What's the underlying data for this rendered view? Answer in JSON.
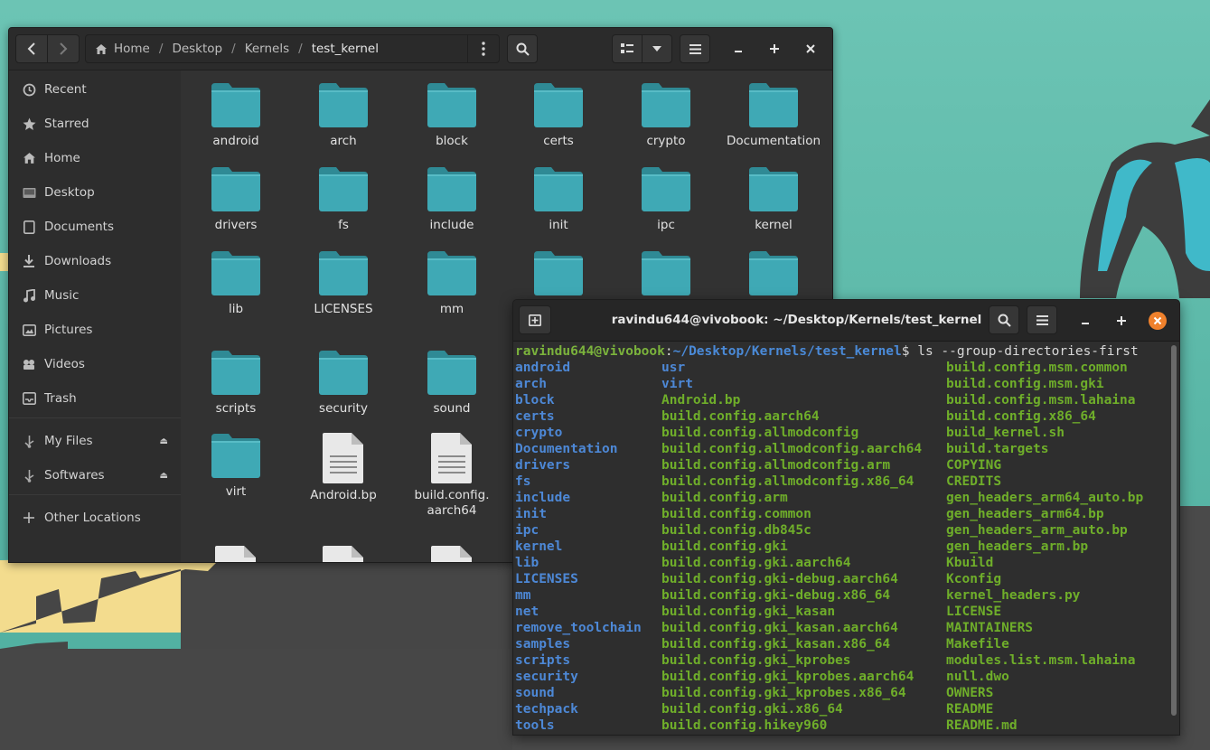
{
  "file_manager": {
    "breadcrumbs": [
      "Home",
      "Desktop",
      "Kernels",
      "test_kernel"
    ],
    "sidebar": [
      {
        "label": "Recent",
        "icon": "clock-icon"
      },
      {
        "label": "Starred",
        "icon": "star-icon"
      },
      {
        "label": "Home",
        "icon": "home-icon"
      },
      {
        "label": "Desktop",
        "icon": "desktop-icon"
      },
      {
        "label": "Documents",
        "icon": "document-icon"
      },
      {
        "label": "Downloads",
        "icon": "download-icon"
      },
      {
        "label": "Music",
        "icon": "music-icon"
      },
      {
        "label": "Pictures",
        "icon": "picture-icon"
      },
      {
        "label": "Videos",
        "icon": "video-icon"
      },
      {
        "label": "Trash",
        "icon": "trash-icon"
      },
      {
        "label": "My Files",
        "icon": "usb-drive-icon"
      },
      {
        "label": "Softwares",
        "icon": "usb-drive-icon"
      },
      {
        "label": "Other Locations",
        "icon": "plus-icon"
      }
    ],
    "items": [
      {
        "label": "android",
        "type": "folder"
      },
      {
        "label": "arch",
        "type": "folder"
      },
      {
        "label": "block",
        "type": "folder"
      },
      {
        "label": "certs",
        "type": "folder"
      },
      {
        "label": "crypto",
        "type": "folder"
      },
      {
        "label": "Documentation",
        "type": "folder"
      },
      {
        "label": "drivers",
        "type": "folder"
      },
      {
        "label": "fs",
        "type": "folder"
      },
      {
        "label": "include",
        "type": "folder"
      },
      {
        "label": "init",
        "type": "folder"
      },
      {
        "label": "ipc",
        "type": "folder"
      },
      {
        "label": "kernel",
        "type": "folder"
      },
      {
        "label": "lib",
        "type": "folder"
      },
      {
        "label": "LICENSES",
        "type": "folder"
      },
      {
        "label": "mm",
        "type": "folder"
      },
      {
        "label": "",
        "type": "folder"
      },
      {
        "label": "",
        "type": "folder"
      },
      {
        "label": "",
        "type": "folder"
      },
      {
        "label": "scripts",
        "type": "folder"
      },
      {
        "label": "security",
        "type": "folder"
      },
      {
        "label": "sound",
        "type": "folder"
      },
      {
        "label": "virt",
        "type": "folder"
      },
      {
        "label": "Android.bp",
        "type": "file"
      },
      {
        "label": "build.config.\naarch64",
        "type": "file"
      },
      {
        "label": "",
        "type": "file"
      },
      {
        "label": "",
        "type": "file"
      },
      {
        "label": "",
        "type": "file"
      }
    ],
    "colors": {
      "folder": "#3fa9b5",
      "folder_tab": "#2f8a95"
    }
  },
  "terminal": {
    "title": "ravindu644@vivobook: ~/Desktop/Kernels/test_kernel",
    "prompt_user": "ravindu644@vivobook",
    "prompt_path": "~/Desktop/Kernels/test_kernel",
    "command": "$ ls --group-directories-first",
    "columns": [
      {
        "items": [
          {
            "t": "android",
            "k": "dir"
          },
          {
            "t": "arch",
            "k": "dir"
          },
          {
            "t": "block",
            "k": "dir"
          },
          {
            "t": "certs",
            "k": "dir"
          },
          {
            "t": "crypto",
            "k": "dir"
          },
          {
            "t": "Documentation",
            "k": "dir"
          },
          {
            "t": "drivers",
            "k": "dir"
          },
          {
            "t": "fs",
            "k": "dir"
          },
          {
            "t": "include",
            "k": "dir"
          },
          {
            "t": "init",
            "k": "dir"
          },
          {
            "t": "ipc",
            "k": "dir"
          },
          {
            "t": "kernel",
            "k": "dir"
          },
          {
            "t": "lib",
            "k": "dir"
          },
          {
            "t": "LICENSES",
            "k": "dir"
          },
          {
            "t": "mm",
            "k": "dir"
          },
          {
            "t": "net",
            "k": "dir"
          },
          {
            "t": "remove_toolchain",
            "k": "dir"
          },
          {
            "t": "samples",
            "k": "dir"
          },
          {
            "t": "scripts",
            "k": "dir"
          },
          {
            "t": "security",
            "k": "dir"
          },
          {
            "t": "sound",
            "k": "dir"
          },
          {
            "t": "techpack",
            "k": "dir"
          },
          {
            "t": "tools",
            "k": "dir"
          }
        ]
      },
      {
        "items": [
          {
            "t": "usr",
            "k": "dir"
          },
          {
            "t": "virt",
            "k": "dir"
          },
          {
            "t": "Android.bp",
            "k": "file"
          },
          {
            "t": "build.config.aarch64",
            "k": "file"
          },
          {
            "t": "build.config.allmodconfig",
            "k": "file"
          },
          {
            "t": "build.config.allmodconfig.aarch64",
            "k": "file"
          },
          {
            "t": "build.config.allmodconfig.arm",
            "k": "file"
          },
          {
            "t": "build.config.allmodconfig.x86_64",
            "k": "file"
          },
          {
            "t": "build.config.arm",
            "k": "file"
          },
          {
            "t": "build.config.common",
            "k": "file"
          },
          {
            "t": "build.config.db845c",
            "k": "file"
          },
          {
            "t": "build.config.gki",
            "k": "file"
          },
          {
            "t": "build.config.gki.aarch64",
            "k": "file"
          },
          {
            "t": "build.config.gki-debug.aarch64",
            "k": "file"
          },
          {
            "t": "build.config.gki-debug.x86_64",
            "k": "file"
          },
          {
            "t": "build.config.gki_kasan",
            "k": "file"
          },
          {
            "t": "build.config.gki_kasan.aarch64",
            "k": "file"
          },
          {
            "t": "build.config.gki_kasan.x86_64",
            "k": "file"
          },
          {
            "t": "build.config.gki_kprobes",
            "k": "file"
          },
          {
            "t": "build.config.gki_kprobes.aarch64",
            "k": "file"
          },
          {
            "t": "build.config.gki_kprobes.x86_64",
            "k": "file"
          },
          {
            "t": "build.config.gki.x86_64",
            "k": "file"
          },
          {
            "t": "build.config.hikey960",
            "k": "file"
          }
        ]
      },
      {
        "items": [
          {
            "t": "build.config.msm.common",
            "k": "file"
          },
          {
            "t": "build.config.msm.gki",
            "k": "file"
          },
          {
            "t": "build.config.msm.lahaina",
            "k": "file"
          },
          {
            "t": "build.config.x86_64",
            "k": "file"
          },
          {
            "t": "build_kernel.sh",
            "k": "file"
          },
          {
            "t": "build.targets",
            "k": "file"
          },
          {
            "t": "COPYING",
            "k": "file"
          },
          {
            "t": "CREDITS",
            "k": "file"
          },
          {
            "t": "gen_headers_arm64_auto.bp",
            "k": "file"
          },
          {
            "t": "gen_headers_arm64.bp",
            "k": "file"
          },
          {
            "t": "gen_headers_arm_auto.bp",
            "k": "file"
          },
          {
            "t": "gen_headers_arm.bp",
            "k": "file"
          },
          {
            "t": "Kbuild",
            "k": "file"
          },
          {
            "t": "Kconfig",
            "k": "file"
          },
          {
            "t": "kernel_headers.py",
            "k": "file"
          },
          {
            "t": "LICENSE",
            "k": "file"
          },
          {
            "t": "MAINTAINERS",
            "k": "file"
          },
          {
            "t": "Makefile",
            "k": "file"
          },
          {
            "t": "modules.list.msm.lahaina",
            "k": "file"
          },
          {
            "t": "null.dwo",
            "k": "file"
          },
          {
            "t": "OWNERS",
            "k": "file"
          },
          {
            "t": "README",
            "k": "file"
          },
          {
            "t": "README.md",
            "k": "file"
          }
        ]
      }
    ],
    "colors": {
      "dir": "#4d88d6",
      "file": "#6fae2a",
      "close_button": "#f0812c"
    }
  }
}
